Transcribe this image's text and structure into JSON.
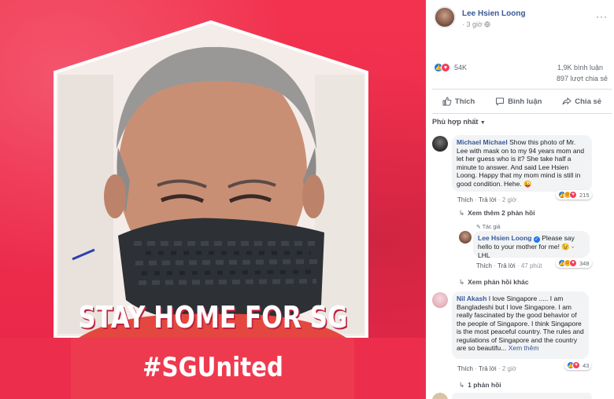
{
  "image": {
    "headline": "STAY HOME FOR SG",
    "hashtag": "#SGUnited"
  },
  "post": {
    "author": "Lee Hsien Loong",
    "time": "3 giờ",
    "privacy_icon": "globe-icon",
    "more_icon": "more-dots-icon",
    "reactions_count": "54K",
    "comments_count": "1,9K bình luận",
    "shares_count": "897 lượt chia sẻ"
  },
  "actions": {
    "like": "Thích",
    "comment": "Bình luận",
    "share": "Chia sẻ"
  },
  "sort_label": "Phù hợp nhất",
  "comments": [
    {
      "name": "Michael Michael",
      "text": "Show this photo of Mr. Lee with mask on to my 94 years mom and let her guess who is it? She take half a minute to answer. And said Lee Hsien Loong. Happy that my mom mind is still in good condition. Hehe. 😜",
      "like": "Thích",
      "reply": "Trả lời",
      "time": "2 giờ",
      "reactions": "215",
      "more_replies": "Xem thêm 2 phản hồi"
    },
    {
      "author_tag": "Tác giả",
      "name": "Lee Hsien Loong",
      "text": "Please say hello to your mother for me! 😉 - LHL",
      "like": "Thích",
      "reply": "Trả lời",
      "time": "47 phút",
      "reactions": "348",
      "other_replies": "Xem phản hồi khác"
    },
    {
      "name": "Nil Akash",
      "text": "I love Singapore ..... I am Bangladeshi but I love Singapore. I am really fascinated by the good behavior of the people of Singapore. I think Singapore is the most peaceful country. The rules and regulations of Singapore and the country are so beautifu...",
      "see_more": "Xem thêm",
      "like": "Thích",
      "reply": "Trả lời",
      "time": "2 giờ",
      "reactions": "43",
      "replies": "1 phản hồi"
    }
  ],
  "colors": {
    "brand_red": "#ee2b4b",
    "fb_blue": "#385898",
    "like_blue": "#1877f2"
  }
}
